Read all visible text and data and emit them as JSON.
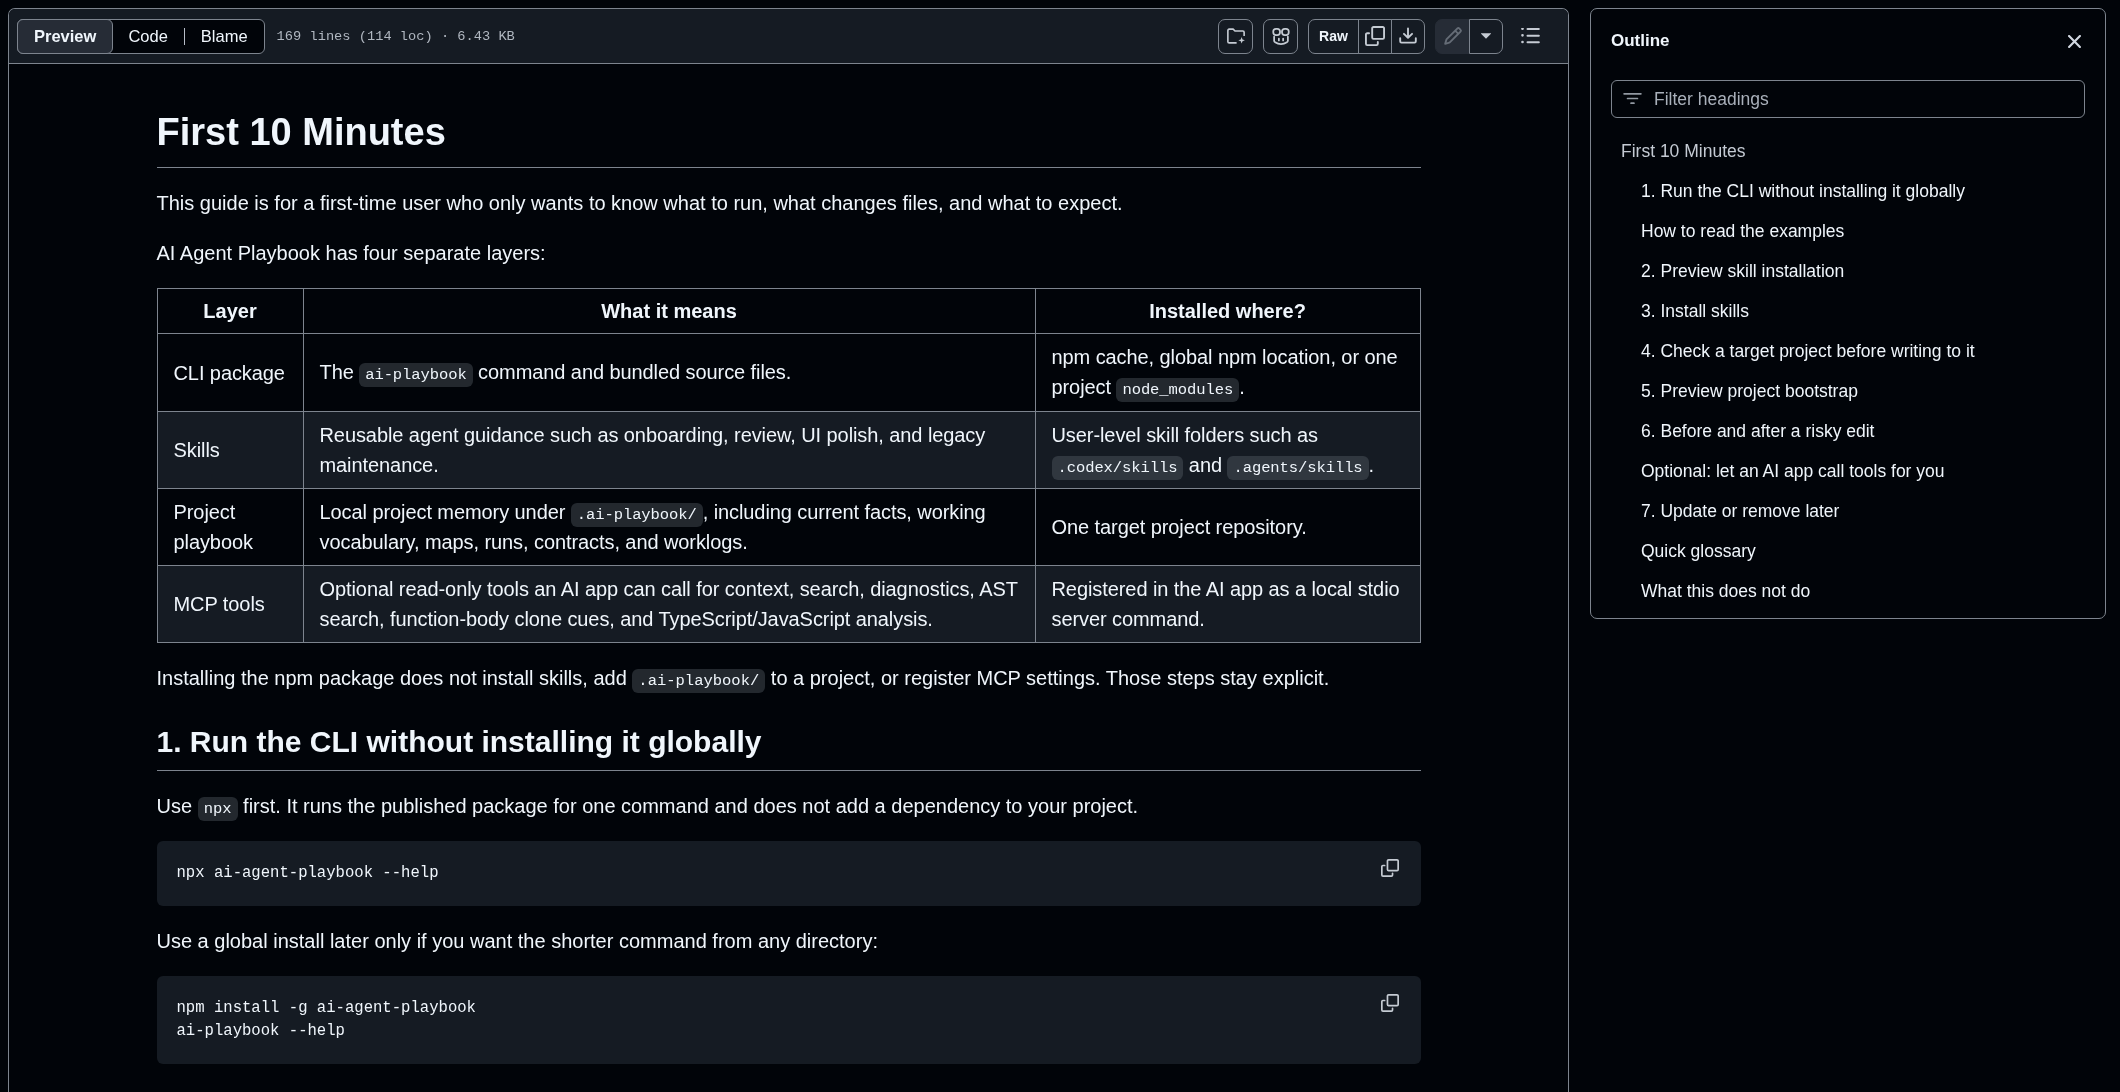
{
  "file_header": {
    "view_tabs": [
      {
        "label": "Preview",
        "selected": true
      },
      {
        "label": "Code",
        "selected": false
      },
      {
        "label": "Blame",
        "selected": false
      }
    ],
    "file_info": "169 lines (114 loc) · 6.43 KB",
    "raw_button": {
      "label": "Raw"
    },
    "edit_button": {
      "disabled": true
    }
  },
  "document": [
    {
      "kind": "heading1",
      "text": "First 10 Minutes"
    },
    {
      "kind": "paragraph",
      "text": "This guide is for a first-time user who only wants to know what to run, what changes files, and what to expect."
    },
    {
      "kind": "paragraph",
      "text": "AI Agent Playbook has four separate layers:"
    },
    {
      "kind": "table",
      "columns": [
        "Layer",
        "What it means",
        "Installed where?"
      ],
      "rows": [
        [
          "CLI package",
          [
            {
              "kind": "text",
              "text": "The "
            },
            {
              "kind": "code",
              "text": "ai-playbook"
            },
            {
              "kind": "text",
              "text": " command and bundled source files."
            }
          ],
          [
            {
              "kind": "text",
              "text": "npm cache, global npm location, or one project "
            },
            {
              "kind": "code",
              "text": "node_modules"
            },
            {
              "kind": "text",
              "text": "."
            }
          ]
        ],
        [
          "Skills",
          "Reusable agent guidance such as onboarding, review, UI polish, and legacy maintenance.",
          [
            {
              "kind": "text",
              "text": "User-level skill folders such as "
            },
            {
              "kind": "code",
              "text": ".codex/skills"
            },
            {
              "kind": "text",
              "text": " and "
            },
            {
              "kind": "code",
              "text": ".agents/skills"
            },
            {
              "kind": "text",
              "text": "."
            }
          ]
        ],
        [
          "Project playbook",
          [
            {
              "kind": "text",
              "text": "Local project memory under "
            },
            {
              "kind": "code",
              "text": ".ai-playbook/"
            },
            {
              "kind": "text",
              "text": ", including current facts, working vocabulary, maps, runs, contracts, and worklogs."
            }
          ],
          "One target project repository."
        ],
        [
          "MCP tools",
          "Optional read-only tools an AI app can call for context, search, diagnostics, AST search, function-body clone cues, and TypeScript/JavaScript analysis.",
          "Registered in the AI app as a local stdio server command."
        ]
      ]
    },
    {
      "kind": "paragraph",
      "text": [
        {
          "kind": "text",
          "text": "Installing the npm package does not install skills, add "
        },
        {
          "kind": "code",
          "text": ".ai-playbook/"
        },
        {
          "kind": "text",
          "text": " to a project, or register MCP settings. Those steps stay explicit."
        }
      ]
    },
    {
      "kind": "heading2",
      "text": "1. Run the CLI without installing it globally"
    },
    {
      "kind": "paragraph",
      "text": [
        {
          "kind": "text",
          "text": "Use "
        },
        {
          "kind": "code",
          "text": "npx"
        },
        {
          "kind": "text",
          "text": " first. It runs the published package for one command and does not add a dependency to your project."
        }
      ]
    },
    {
      "kind": "code_block",
      "lines": [
        "npx ai-agent-playbook --help"
      ]
    },
    {
      "kind": "paragraph",
      "text": "Use a global install later only if you want the shorter command from any directory:"
    },
    {
      "kind": "code_block",
      "lines": [
        "npm install -g ai-agent-playbook",
        "ai-playbook --help"
      ]
    }
  ],
  "outline": {
    "title": "Outline",
    "filter": {
      "placeholder": "Filter headings"
    },
    "items": [
      {
        "label": "First 10 Minutes",
        "children": [
          {
            "label": "1. Run the CLI without installing it globally"
          },
          {
            "label": "How to read the examples"
          },
          {
            "label": "2. Preview skill installation"
          },
          {
            "label": "3. Install skills"
          },
          {
            "label": "4. Check a target project before writing to it"
          },
          {
            "label": "5. Preview project bootstrap"
          },
          {
            "label": "6. Before and after a risky edit"
          },
          {
            "label": "Optional: let an AI app call tools for you"
          },
          {
            "label": "7. Update or remove later"
          },
          {
            "label": "Quick glossary"
          },
          {
            "label": "What this does not do"
          }
        ]
      }
    ]
  }
}
